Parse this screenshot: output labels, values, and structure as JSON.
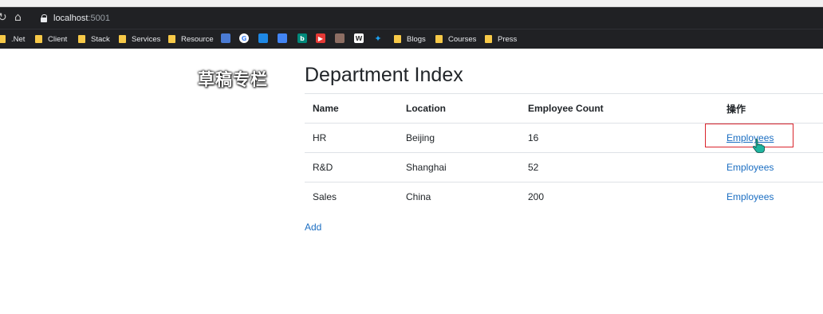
{
  "browser": {
    "url_host": "localhost",
    "url_port": ":5001",
    "bookmarks": {
      "net": ".Net",
      "client": "Client",
      "stack": "Stack",
      "services": "Services",
      "resource": "Resource",
      "blogs": "Blogs",
      "courses": "Courses",
      "press": "Press"
    }
  },
  "watermark": "草稿专栏",
  "page": {
    "title": "Department Index",
    "add_label": "Add"
  },
  "table": {
    "headers": {
      "name": "Name",
      "location": "Location",
      "count": "Employee Count",
      "action": "操作"
    },
    "rows": [
      {
        "name": "HR",
        "location": "Beijing",
        "count": "16",
        "action": "Employees"
      },
      {
        "name": "R&D",
        "location": "Shanghai",
        "count": "52",
        "action": "Employees"
      },
      {
        "name": "Sales",
        "location": "China",
        "count": "200",
        "action": "Employees"
      }
    ]
  },
  "colors": {
    "link": "#1b6ec2",
    "highlight": "#d9242c",
    "browser_bg": "#202124",
    "folder": "#f7c948"
  }
}
